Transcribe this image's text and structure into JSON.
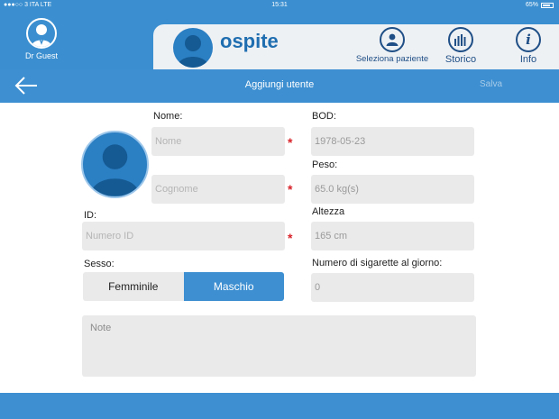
{
  "status_bar": {
    "carrier": "●●●○○ 3 ITA   LTE",
    "time": "15:31",
    "battery": "65%"
  },
  "header": {
    "doctor_name": "Dr Guest",
    "patient_name": "ospite",
    "nav": {
      "select_patient": "Seleziona paziente",
      "history": "Storico",
      "info": "Info"
    }
  },
  "titlebar": {
    "title": "Aggiungi utente",
    "save": "Salva"
  },
  "form": {
    "name_label": "Nome:",
    "name_placeholder": "Nome",
    "surname_placeholder": "Cognome",
    "id_label": "ID:",
    "id_placeholder": "Numero ID",
    "sex_label": "Sesso:",
    "sex_options": [
      "Femminile",
      "Maschio"
    ],
    "sex_selected": "Maschio",
    "bod_label": "BOD:",
    "bod_value": "1978-05-23",
    "weight_label": "Peso:",
    "weight_value": "65.0 kg(s)",
    "height_label": "Altezza",
    "height_value": "165 cm",
    "cigarettes_label": "Numero di sigarette al giorno:",
    "cigarettes_value": "0",
    "notes_placeholder": "Note",
    "required_mark": "*"
  },
  "colors": {
    "primary": "#3d8fd1",
    "dark_accent": "#1f4f86",
    "field_bg": "#eaeaea",
    "required": "#d8232a"
  }
}
